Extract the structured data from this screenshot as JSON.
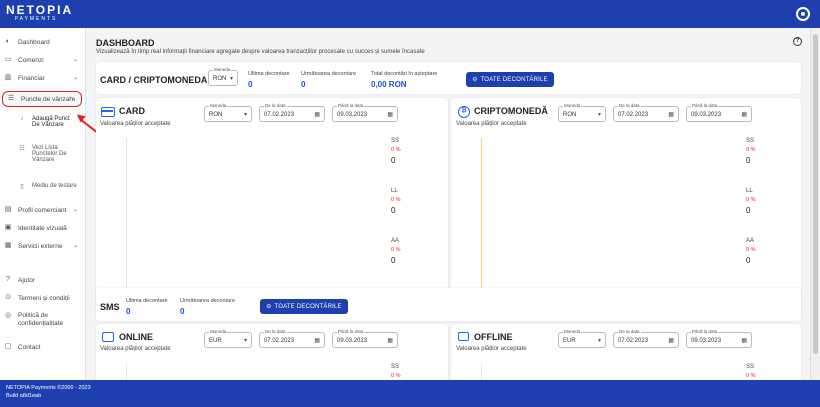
{
  "header": {
    "logo_main": "NETOPIA",
    "logo_sub": "PAYMENTS"
  },
  "sidebar": {
    "items": [
      {
        "label": "Dashboard",
        "icon": "dashboard-icon"
      },
      {
        "label": "Comenzi",
        "icon": "orders-icon"
      },
      {
        "label": "Financiar",
        "icon": "finance-icon"
      },
      {
        "label": "Puncte de vânzare",
        "icon": "pos-icon"
      },
      {
        "label": "Profil comerciant",
        "icon": "profile-icon"
      },
      {
        "label": "Identitate vizuală",
        "icon": "identity-icon"
      },
      {
        "label": "Servicii externe",
        "icon": "services-icon"
      },
      {
        "label": "Ajutor",
        "icon": "help-icon"
      },
      {
        "label": "Termeni și condiții",
        "icon": "terms-icon"
      },
      {
        "label": "Politică de confidențialitate",
        "icon": "privacy-icon"
      },
      {
        "label": "Contact",
        "icon": "contact-icon"
      }
    ],
    "sub_items": [
      {
        "label": "Adaugă Punct De Vânzare"
      },
      {
        "label": "Vezi Lista Punctelor De Vânzare"
      },
      {
        "label": "Mediu de testare"
      }
    ]
  },
  "page": {
    "title": "DASHBOARD",
    "subtitle": "Vizualizează în timp real informații financiare agregate despre valoarea tranzacțiilor procesate cu succes și sumele încasate"
  },
  "card_crypto_summary": {
    "title": "CARD / CRIPTOMONEDA",
    "currency_label": "Moneda",
    "currency_value": "RON",
    "stats": [
      {
        "label": "Ultima decontare",
        "value": "0"
      },
      {
        "label": "Următoarea decontare",
        "value": "0"
      },
      {
        "label": "Total decontări în așteptare",
        "value": "0,00 RON"
      }
    ],
    "button": "TOATE DECONTĂRILE"
  },
  "card_panel": {
    "title": "CARD",
    "subtitle": "Valoarea plăților acceptate",
    "currency_label": "Moneda",
    "currency_value": "RON",
    "from_label": "De la data",
    "from_value": "07.02.2023",
    "to_label": "Până la data",
    "to_value": "09.03.2023",
    "legend": [
      {
        "name": "SS",
        "pct": "0 %",
        "value": "0"
      },
      {
        "name": "LL",
        "pct": "0 %",
        "value": "0"
      },
      {
        "name": "AA",
        "pct": "0 %",
        "value": "0"
      }
    ]
  },
  "crypto_panel": {
    "title": "CRIPTOMONEDĂ",
    "subtitle": "Valoarea plăților acceptate",
    "currency_label": "Moneda",
    "currency_value": "RON",
    "from_label": "De la data",
    "from_value": "07.02.2023",
    "to_label": "Până la data",
    "to_value": "09.03.2023",
    "legend": [
      {
        "name": "SS",
        "pct": "0 %",
        "value": "0"
      },
      {
        "name": "LL",
        "pct": "0 %",
        "value": "0"
      },
      {
        "name": "AA",
        "pct": "0 %",
        "value": "0"
      }
    ]
  },
  "sms_summary": {
    "title": "SMS",
    "stats": [
      {
        "label": "Ultima decontare",
        "value": "0"
      },
      {
        "label": "Următoarea decontare",
        "value": "0"
      }
    ],
    "button": "TOATE DECONTĂRILE"
  },
  "online_panel": {
    "title": "ONLINE",
    "subtitle": "Valoarea plăților acceptate",
    "currency_label": "Moneda",
    "currency_value": "EUR",
    "from_label": "De la data",
    "from_value": "07.02.2023",
    "to_label": "Până la data",
    "to_value": "09.03.2023",
    "legend": [
      {
        "name": "SS",
        "pct": "0 %"
      }
    ]
  },
  "offline_panel": {
    "title": "OFFLINE",
    "subtitle": "Valoarea plăților acceptate",
    "currency_label": "Moneda",
    "currency_value": "EUR",
    "from_label": "De la data",
    "from_value": "07.02.2023",
    "to_label": "Până la data",
    "to_value": "09.03.2023",
    "legend": [
      {
        "name": "SS",
        "pct": "0 %"
      }
    ]
  },
  "footer": {
    "copyright": "NETOPIA Payments ©2000 - 2023",
    "build": "Build a8d1eab"
  },
  "colors": {
    "brand": "#1e40af",
    "accent": "#2563eb",
    "alert": "#dc2626"
  }
}
